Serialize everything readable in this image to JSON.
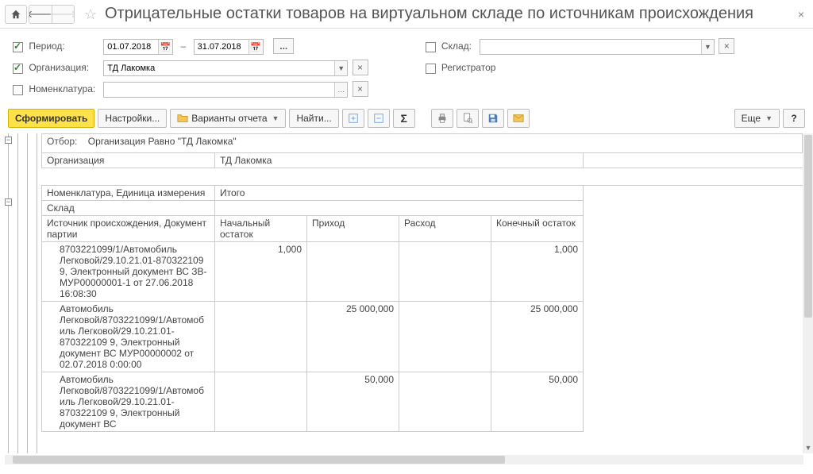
{
  "title": "Отрицательные остатки товаров на виртуальном складе по источникам происхождения",
  "filters": {
    "period": {
      "label": "Период:",
      "from": "01.07.2018",
      "to": "31.07.2018",
      "checked": true
    },
    "organization": {
      "label": "Организация:",
      "value": "ТД Лакомка",
      "checked": true
    },
    "nomenclature": {
      "label": "Номенклатура:",
      "value": "",
      "checked": false
    },
    "warehouse": {
      "label": "Склад:",
      "value": "",
      "checked": false
    },
    "registrar": {
      "label": "Регистратор",
      "checked": false
    }
  },
  "toolbar": {
    "generate": "Сформировать",
    "settings": "Настройки...",
    "variants": "Варианты отчета",
    "find": "Найти...",
    "more": "Еще"
  },
  "report": {
    "filter_line_label": "Отбор:",
    "filter_line_value": "Организация Равно \"ТД Лакомка\"",
    "org_label": "Организация",
    "org_value": "ТД Лакомка",
    "group1": "Номенклатура, Единица измерения",
    "group2": "Склад",
    "group3": "Источник происхождения, Документ партии",
    "total_label": "Итого",
    "cols": {
      "c1": "Начальный остаток",
      "c2": "Приход",
      "c3": "Расход",
      "c4": "Конечный остаток"
    },
    "rows": [
      {
        "name": "8703221099/1/Автомобиль Легковой/29.10.21.01-870322109 9, Электронный документ ВС ЗВ-МУР00000001-1 от 27.06.2018 16:08:30",
        "start": "1,000",
        "in": "",
        "out": "",
        "end": "1,000"
      },
      {
        "name": "Автомобиль Легковой/8703221099/1/Автомоб иль Легковой/29.10.21.01-870322109 9, Электронный документ ВС МУР00000002 от 02.07.2018 0:00:00",
        "start": "",
        "in": "25 000,000",
        "out": "",
        "end": "25 000,000"
      },
      {
        "name": "Автомобиль Легковой/8703221099/1/Автомоб иль Легковой/29.10.21.01-870322109 9, Электронный документ ВС",
        "start": "",
        "in": "50,000",
        "out": "",
        "end": "50,000"
      }
    ]
  }
}
